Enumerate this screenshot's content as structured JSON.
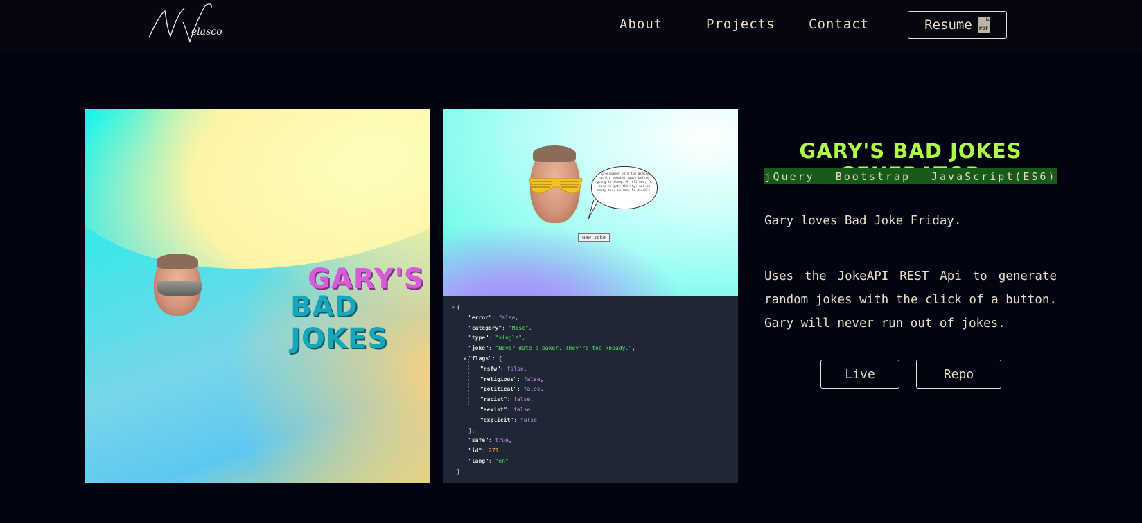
{
  "nav": {
    "logo_text": "N Velasco",
    "links": [
      "About",
      "Projects",
      "Contact"
    ],
    "resume_label": "Resume",
    "resume_icon": "pdf-icon",
    "pdf_badge": "PDF"
  },
  "hero_image": {
    "title_line1": "GARY'S",
    "title_line2": "BAD JOKES"
  },
  "screenshot": {
    "speech_text": "A programmer puts two glasses on his bedside table before going to sleep. A full one, in case he gets thirsty, and an empty one, in case he doesn't.",
    "button_label": "New Joke",
    "json_lines": [
      {
        "ind": 0,
        "tri": true,
        "parts": [
          [
            "p",
            "{"
          ]
        ]
      },
      {
        "ind": 1,
        "parts": [
          [
            "k",
            "\"error\""
          ],
          [
            "p",
            ": "
          ],
          [
            "b",
            "false"
          ],
          [
            "p",
            ","
          ]
        ]
      },
      {
        "ind": 1,
        "parts": [
          [
            "k",
            "\"category\""
          ],
          [
            "p",
            ": "
          ],
          [
            "s",
            "\"Misc\""
          ],
          [
            "p",
            ","
          ]
        ]
      },
      {
        "ind": 1,
        "parts": [
          [
            "k",
            "\"type\""
          ],
          [
            "p",
            ": "
          ],
          [
            "s",
            "\"single\""
          ],
          [
            "p",
            ","
          ]
        ]
      },
      {
        "ind": 1,
        "parts": [
          [
            "k",
            "\"joke\""
          ],
          [
            "p",
            ": "
          ],
          [
            "s",
            "\"Never date a baker. They're too kneady.\""
          ],
          [
            "p",
            ","
          ]
        ]
      },
      {
        "ind": 1,
        "tri": true,
        "parts": [
          [
            "k",
            "\"flags\""
          ],
          [
            "p",
            ": {"
          ]
        ]
      },
      {
        "ind": 2,
        "parts": [
          [
            "k",
            "\"nsfw\""
          ],
          [
            "p",
            ": "
          ],
          [
            "b",
            "false"
          ],
          [
            "p",
            ","
          ]
        ]
      },
      {
        "ind": 2,
        "parts": [
          [
            "k",
            "\"religious\""
          ],
          [
            "p",
            ": "
          ],
          [
            "b",
            "false"
          ],
          [
            "p",
            ","
          ]
        ]
      },
      {
        "ind": 2,
        "parts": [
          [
            "k",
            "\"political\""
          ],
          [
            "p",
            ": "
          ],
          [
            "b",
            "false"
          ],
          [
            "p",
            ","
          ]
        ]
      },
      {
        "ind": 2,
        "parts": [
          [
            "k",
            "\"racist\""
          ],
          [
            "p",
            ": "
          ],
          [
            "b",
            "false"
          ],
          [
            "p",
            ","
          ]
        ]
      },
      {
        "ind": 2,
        "parts": [
          [
            "k",
            "\"sexist\""
          ],
          [
            "p",
            ": "
          ],
          [
            "b",
            "false"
          ],
          [
            "p",
            ","
          ]
        ]
      },
      {
        "ind": 2,
        "parts": [
          [
            "k",
            "\"explicit\""
          ],
          [
            "p",
            ": "
          ],
          [
            "b",
            "false"
          ]
        ]
      },
      {
        "ind": 1,
        "parts": [
          [
            "p",
            "},"
          ]
        ]
      },
      {
        "ind": 1,
        "parts": [
          [
            "k",
            "\"safe\""
          ],
          [
            "p",
            ": "
          ],
          [
            "b",
            "true"
          ],
          [
            "p",
            ","
          ]
        ]
      },
      {
        "ind": 1,
        "parts": [
          [
            "k",
            "\"id\""
          ],
          [
            "p",
            ": "
          ],
          [
            "n",
            "271"
          ],
          [
            "p",
            ","
          ]
        ]
      },
      {
        "ind": 1,
        "parts": [
          [
            "k",
            "\"lang\""
          ],
          [
            "p",
            ": "
          ],
          [
            "s",
            "\"en\""
          ]
        ]
      },
      {
        "ind": 0,
        "parts": [
          [
            "p",
            "}"
          ]
        ]
      }
    ]
  },
  "project": {
    "title": "GARY'S BAD JOKES GENERATOR",
    "tech": [
      "jQuery",
      "Bootstrap",
      "JavaScript(ES6)"
    ],
    "desc1": "Gary loves Bad Joke Friday.",
    "desc2": "Uses the JokeAPI REST Api to generate random jokes with the click of a button. Gary will never run out of jokes.",
    "live_label": "Live",
    "repo_label": "Repo"
  }
}
